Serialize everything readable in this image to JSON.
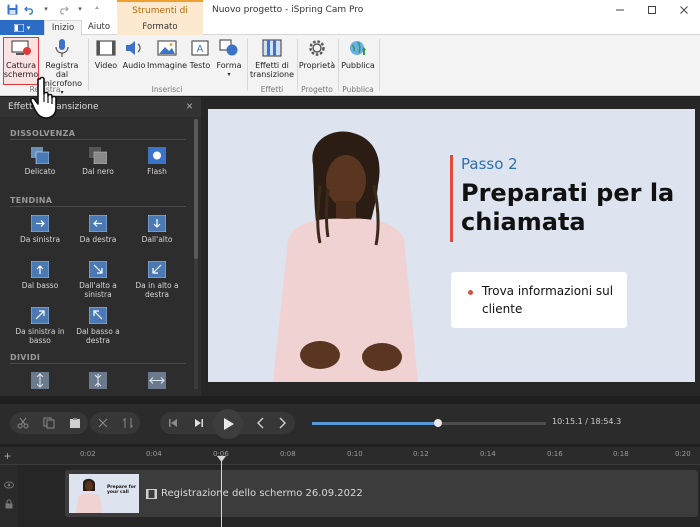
{
  "window": {
    "title": "Nuovo progetto - iSpring Cam Pro",
    "context_tab_group": "Strumenti di disegno",
    "controls": [
      "minimize",
      "maximize",
      "close"
    ]
  },
  "ribbon_tabs": [
    {
      "label": "Inizio",
      "active": true
    },
    {
      "label": "Aiuto",
      "active": false
    },
    {
      "label": "Formato",
      "active": false,
      "contextual": true
    }
  ],
  "ribbon": {
    "buttons": {
      "cattura": "Cattura schermo",
      "registra": "Registra dal microfono",
      "video": "Video",
      "audio": "Audio",
      "immagine": "Immagine",
      "testo": "Testo",
      "forma": "Forma",
      "effetti": "Effetti di transizione",
      "proprieta": "Proprietà",
      "pubblica": "Pubblica"
    },
    "groups": {
      "registra": "Registra",
      "inserisci": "Inserisci",
      "effetti": "Effetti",
      "progetto": "Progetto",
      "pubblica": "Pubblica"
    }
  },
  "panel": {
    "title": "Effetti di transizione",
    "sections": {
      "dissolvenza": {
        "label": "DISSOLVENZA",
        "items": [
          "Delicato",
          "Dal nero",
          "Flash"
        ]
      },
      "tendina": {
        "label": "TENDINA",
        "items": [
          "Da sinistra",
          "Da destra",
          "Dall'alto",
          "Dal basso",
          "Dall'alto a sinistra",
          "Da in alto a destra",
          "Da sinistra in basso",
          "Dal basso a destra"
        ]
      },
      "dividi": {
        "label": "DIVIDI",
        "items": []
      }
    }
  },
  "slide": {
    "step": "Passo 2",
    "heading": "Preparati per la chiamata",
    "card_text": "Trova informazioni sul cliente",
    "accent_color": "#e04b3a",
    "step_color": "#2f6fb0",
    "background": "#dde3ef"
  },
  "playback": {
    "timecode": "10:15.1 / 18:54.3",
    "progress": 0.54
  },
  "timeline": {
    "ticks": [
      "0:02",
      "0:04",
      "0:06",
      "0:08",
      "0:10",
      "0:12",
      "0:14",
      "0:16",
      "0:18",
      "0:20"
    ],
    "clip_name": "Registrazione dello schermo 26.09.2022",
    "clip_thumb_text": "Prepare for your call",
    "playhead_time": "0:06"
  },
  "icons": [
    "undo-icon",
    "redo-icon",
    "save-icon",
    "close-icon",
    "play-icon",
    "cut-icon",
    "paste-icon",
    "previous-icon",
    "next-icon",
    "hand-cursor-icon"
  ]
}
